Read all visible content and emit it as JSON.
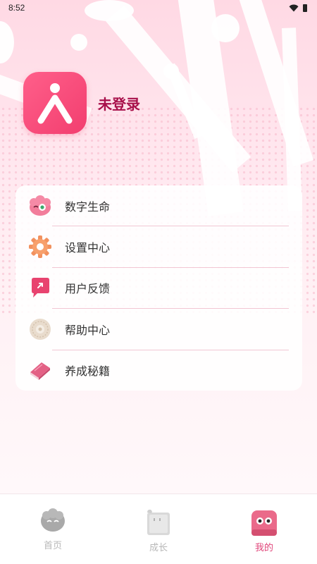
{
  "status_bar": {
    "time": "8:52"
  },
  "profile": {
    "login_status": "未登录"
  },
  "menu": {
    "items": [
      {
        "label": "数字生命",
        "icon": "pink-fluffy-creature-icon"
      },
      {
        "label": "设置中心",
        "icon": "gear-icon"
      },
      {
        "label": "用户反馈",
        "icon": "feedback-bubble-icon"
      },
      {
        "label": "帮助中心",
        "icon": "help-donut-icon"
      },
      {
        "label": "养成秘籍",
        "icon": "book-icon"
      }
    ]
  },
  "tab_bar": {
    "tabs": [
      {
        "label": "首页",
        "icon": "home-creature-icon",
        "active": false
      },
      {
        "label": "成长",
        "icon": "growth-card-icon",
        "active": false
      },
      {
        "label": "我的",
        "icon": "me-cube-icon",
        "active": true
      }
    ]
  },
  "colors": {
    "accent": "#f23e6f",
    "active_tab_text": "#e0457a",
    "inactive_tab_text": "#b8b8b8",
    "login_text": "#a8104a"
  }
}
